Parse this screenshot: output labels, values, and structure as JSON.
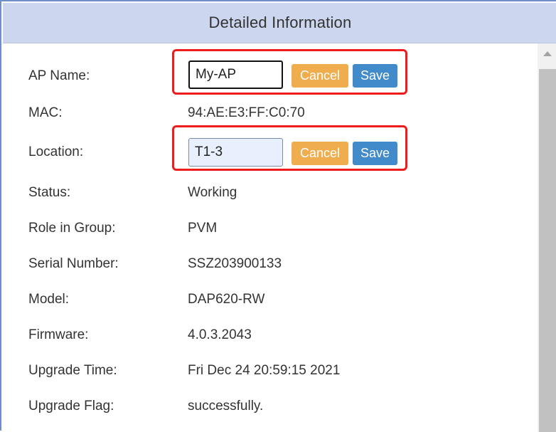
{
  "header": {
    "title": "Detailed Information"
  },
  "fields": {
    "ap_name": {
      "label": "AP Name:",
      "value": "My-AP",
      "cancel_label": "Cancel",
      "save_label": "Save"
    },
    "mac": {
      "label": "MAC:",
      "value": "94:AE:E3:FF:C0:70"
    },
    "location": {
      "label": "Location:",
      "value": "T1-3",
      "cancel_label": "Cancel",
      "save_label": "Save"
    },
    "status": {
      "label": "Status:",
      "value": "Working"
    },
    "role": {
      "label": "Role in Group:",
      "value": "PVM"
    },
    "serial": {
      "label": "Serial Number:",
      "value": "SSZ203900133"
    },
    "model": {
      "label": "Model:",
      "value": "DAP620-RW"
    },
    "firmware": {
      "label": "Firmware:",
      "value": "4.0.3.2043"
    },
    "upgrade_time": {
      "label": "Upgrade Time:",
      "value": "Fri Dec 24 20:59:15 2021"
    },
    "upgrade_flag": {
      "label": "Upgrade Flag:",
      "value": "successfully."
    }
  },
  "colors": {
    "header_bg": "#ccd6ee",
    "highlight_border": "#ee1c1c",
    "cancel_button": "#f0ad4e",
    "save_button": "#428bca"
  },
  "icons": {
    "scroll_up": "triangle-up-icon"
  }
}
